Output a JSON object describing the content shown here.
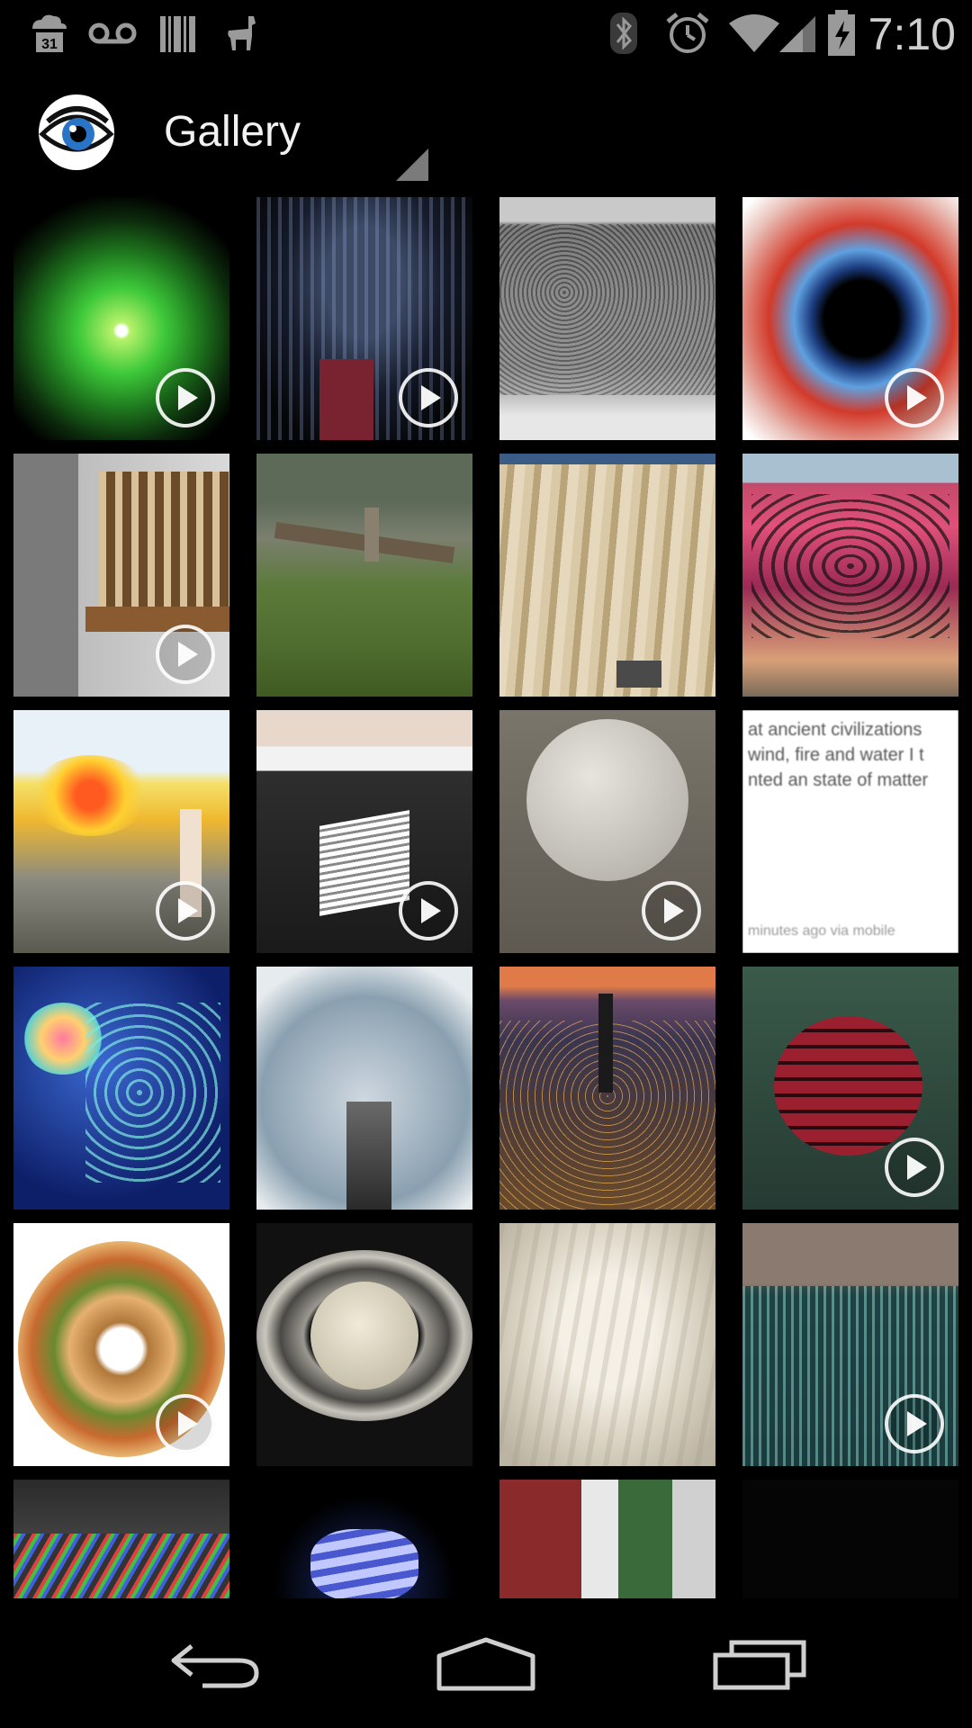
{
  "status_bar": {
    "time": "7:10",
    "calendar_day": "31",
    "icons": [
      "cloud-calendar-icon",
      "voicemail-icon",
      "barcode-icon",
      "llama-icon",
      "bluetooth-icon",
      "alarm-icon",
      "wifi-icon",
      "signal-icon",
      "battery-charging-icon"
    ]
  },
  "action_bar": {
    "title": "Gallery",
    "app_icon": "eye-icon"
  },
  "gallery": {
    "tiles": [
      {
        "name": "cats-eye-nebula",
        "video": true
      },
      {
        "name": "helmet-figure",
        "video": true
      },
      {
        "name": "crowd",
        "video": false
      },
      {
        "name": "red-blue-vortex",
        "video": true
      },
      {
        "name": "wooden-organ",
        "video": true
      },
      {
        "name": "tree-field",
        "video": false
      },
      {
        "name": "fabric-curtain",
        "video": false
      },
      {
        "name": "graffiti-wall",
        "video": false
      },
      {
        "name": "flame-thrower",
        "video": true
      },
      {
        "name": "glowing-cube",
        "video": true
      },
      {
        "name": "stone-sculpture",
        "video": true
      },
      {
        "name": "text-post",
        "video": false
      },
      {
        "name": "psychedelic-elephant",
        "video": false
      },
      {
        "name": "skyscraper-clouds",
        "video": false
      },
      {
        "name": "city-aerial",
        "video": false
      },
      {
        "name": "red-sphere",
        "video": true
      },
      {
        "name": "burger-ring",
        "video": true
      },
      {
        "name": "saturn",
        "video": false
      },
      {
        "name": "veiled-face",
        "video": false
      },
      {
        "name": "crowd-aerial",
        "video": true
      },
      {
        "name": "rainbow-rock",
        "video": false
      },
      {
        "name": "spiral-bulb",
        "video": false
      },
      {
        "name": "red-green-hall",
        "video": false
      },
      {
        "name": "dark-tile",
        "video": false
      }
    ],
    "text_post": {
      "lines": [
        "at ancient civilizations",
        "wind, fire and water I t",
        "nted an state of matter"
      ],
      "footer": "minutes ago via mobile"
    }
  },
  "nav_bar": {
    "buttons": [
      "back-icon",
      "home-icon",
      "recent-apps-icon"
    ]
  },
  "colors": {
    "background": "#000000",
    "status_icon": "#9a9a9a",
    "title_text": "#f2f2f2"
  }
}
